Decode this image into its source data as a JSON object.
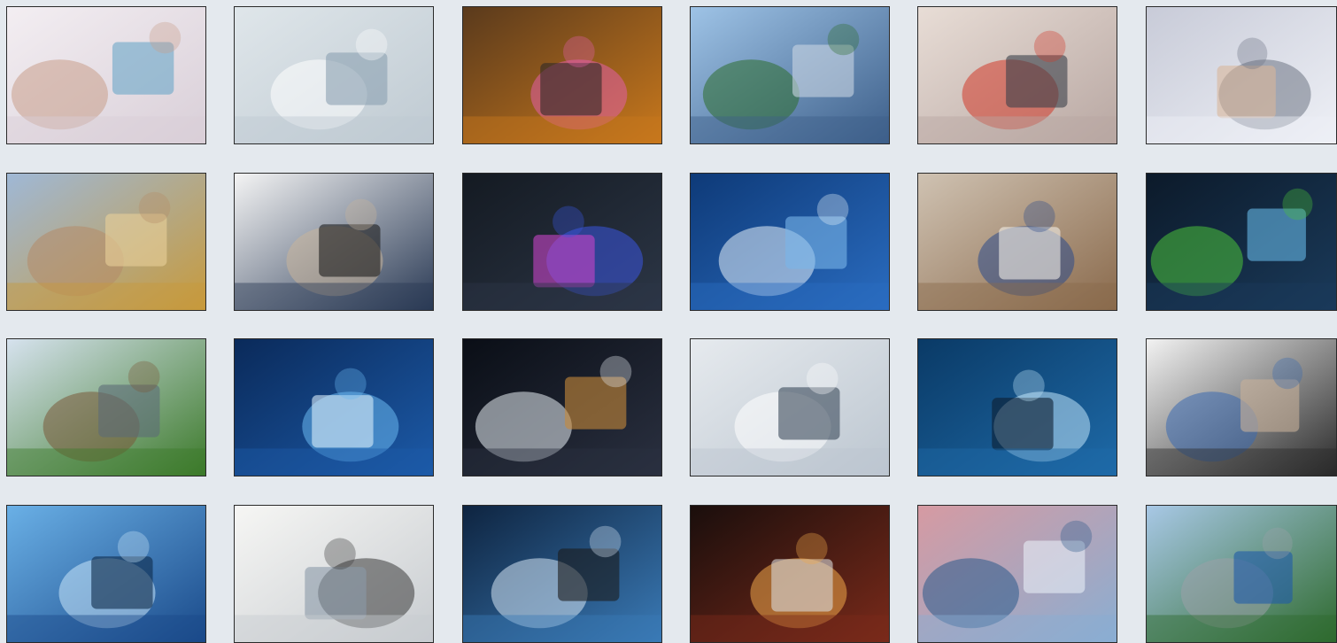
{
  "tiles": [
    {
      "id": "telemedicine-phone-call",
      "icon": "phone-video-call-icon",
      "palette": [
        "#f3eef2",
        "#d9cfd8",
        "#c89f8a",
        "#6aa6c8"
      ]
    },
    {
      "id": "doctor-body-hologram",
      "icon": "human-body-hologram-icon",
      "palette": [
        "#dfe6ea",
        "#bfcad2",
        "#ffffff",
        "#8aa0b0"
      ]
    },
    {
      "id": "family-using-tablet",
      "icon": "tablet-icon",
      "palette": [
        "#5a3a1c",
        "#c8781c",
        "#e25fa8",
        "#2e2a28"
      ]
    },
    {
      "id": "solar-panels-city",
      "icon": "solar-panel-icon",
      "palette": [
        "#9ec3e6",
        "#3d5f8a",
        "#2e6d2e",
        "#c9d6e3"
      ]
    },
    {
      "id": "workers-on-solar-roof",
      "icon": "worker-icon",
      "palette": [
        "#e8ddd6",
        "#b8a7a2",
        "#d23a2a",
        "#3a3f4a"
      ]
    },
    {
      "id": "satellite-dish-array",
      "icon": "satellite-dish-icon",
      "palette": [
        "#c8cbd8",
        "#eef0f6",
        "#6d7484",
        "#d8b59a"
      ]
    },
    {
      "id": "farmer-with-laptop",
      "icon": "laptop-icon",
      "palette": [
        "#9fb8d6",
        "#c79a3c",
        "#b58b68",
        "#e9d09a"
      ]
    },
    {
      "id": "students-computer-lab",
      "icon": "desktop-computer-icon",
      "palette": [
        "#f4f4f4",
        "#2a3a55",
        "#c8b49a",
        "#1c1c1c"
      ]
    },
    {
      "id": "thermal-camera-plant",
      "icon": "thermal-camera-icon",
      "palette": [
        "#141a22",
        "#2c3646",
        "#3a55e0",
        "#c845c8"
      ]
    },
    {
      "id": "medical-touch-interface",
      "icon": "medical-cross-icon",
      "palette": [
        "#0e3a78",
        "#2a6cc0",
        "#e6f0fa",
        "#7ab6ea"
      ]
    },
    {
      "id": "students-library-table",
      "icon": "book-icon",
      "palette": [
        "#cfc2b2",
        "#8a6a4c",
        "#2b4a8a",
        "#f0ece6"
      ]
    },
    {
      "id": "plant-sprout-tech",
      "icon": "sprout-icon",
      "palette": [
        "#0c1a2a",
        "#1a3a5a",
        "#4ac23a",
        "#66b8e6"
      ]
    },
    {
      "id": "farmer-crop-field",
      "icon": "tablet-icon",
      "palette": [
        "#d6e2ee",
        "#3c7a2a",
        "#7a5a3a",
        "#5c6a76"
      ]
    },
    {
      "id": "smart-city-phone",
      "icon": "smartphone-icon",
      "palette": [
        "#0a2a5a",
        "#1c5aa8",
        "#6ab8f0",
        "#d8ecfa"
      ]
    },
    {
      "id": "circuit-screen-night",
      "icon": "circuit-icon",
      "palette": [
        "#0a0e16",
        "#2a3040",
        "#e8eef4",
        "#c88a3a"
      ]
    },
    {
      "id": "doctor-medical-icons",
      "icon": "stethoscope-icon",
      "palette": [
        "#e6eaee",
        "#bcc6d0",
        "#ffffff",
        "#3a4a5a"
      ]
    },
    {
      "id": "connected-city-skyline",
      "icon": "network-icon",
      "palette": [
        "#0a3a66",
        "#1e6aa8",
        "#bfe4fa",
        "#0e1e30"
      ]
    },
    {
      "id": "video-consultation",
      "icon": "laptop-video-icon",
      "palette": [
        "#f2f2f2",
        "#2a2a2a",
        "#3a6ab0",
        "#c8b09a"
      ]
    },
    {
      "id": "smart-city-wifi",
      "icon": "wifi-icon",
      "palette": [
        "#6ab0e6",
        "#1a4a8a",
        "#c8e6fa",
        "#0e2a4a"
      ]
    },
    {
      "id": "office-meeting",
      "icon": "whiteboard-icon",
      "palette": [
        "#f6f6f4",
        "#c8ccd0",
        "#3a3a3a",
        "#8a9aa8"
      ]
    },
    {
      "id": "engineer-monitors",
      "icon": "monitor-icon",
      "palette": [
        "#0e2440",
        "#3a7ab6",
        "#d6e6f4",
        "#1a1a1a"
      ]
    },
    {
      "id": "hand-tech-icons",
      "icon": "hand-touch-icon",
      "palette": [
        "#1a0e0c",
        "#7a2a1a",
        "#f0a84a",
        "#d8d8d8"
      ]
    },
    {
      "id": "offshore-wind-farm",
      "icon": "wind-turbine-icon",
      "palette": [
        "#d69aa2",
        "#8aaed2",
        "#2a5a8a",
        "#e8eef6"
      ]
    },
    {
      "id": "highway-traffic",
      "icon": "car-icon",
      "palette": [
        "#a8c8e6",
        "#2e6a2e",
        "#9aa0a8",
        "#1e5aa8"
      ]
    }
  ]
}
